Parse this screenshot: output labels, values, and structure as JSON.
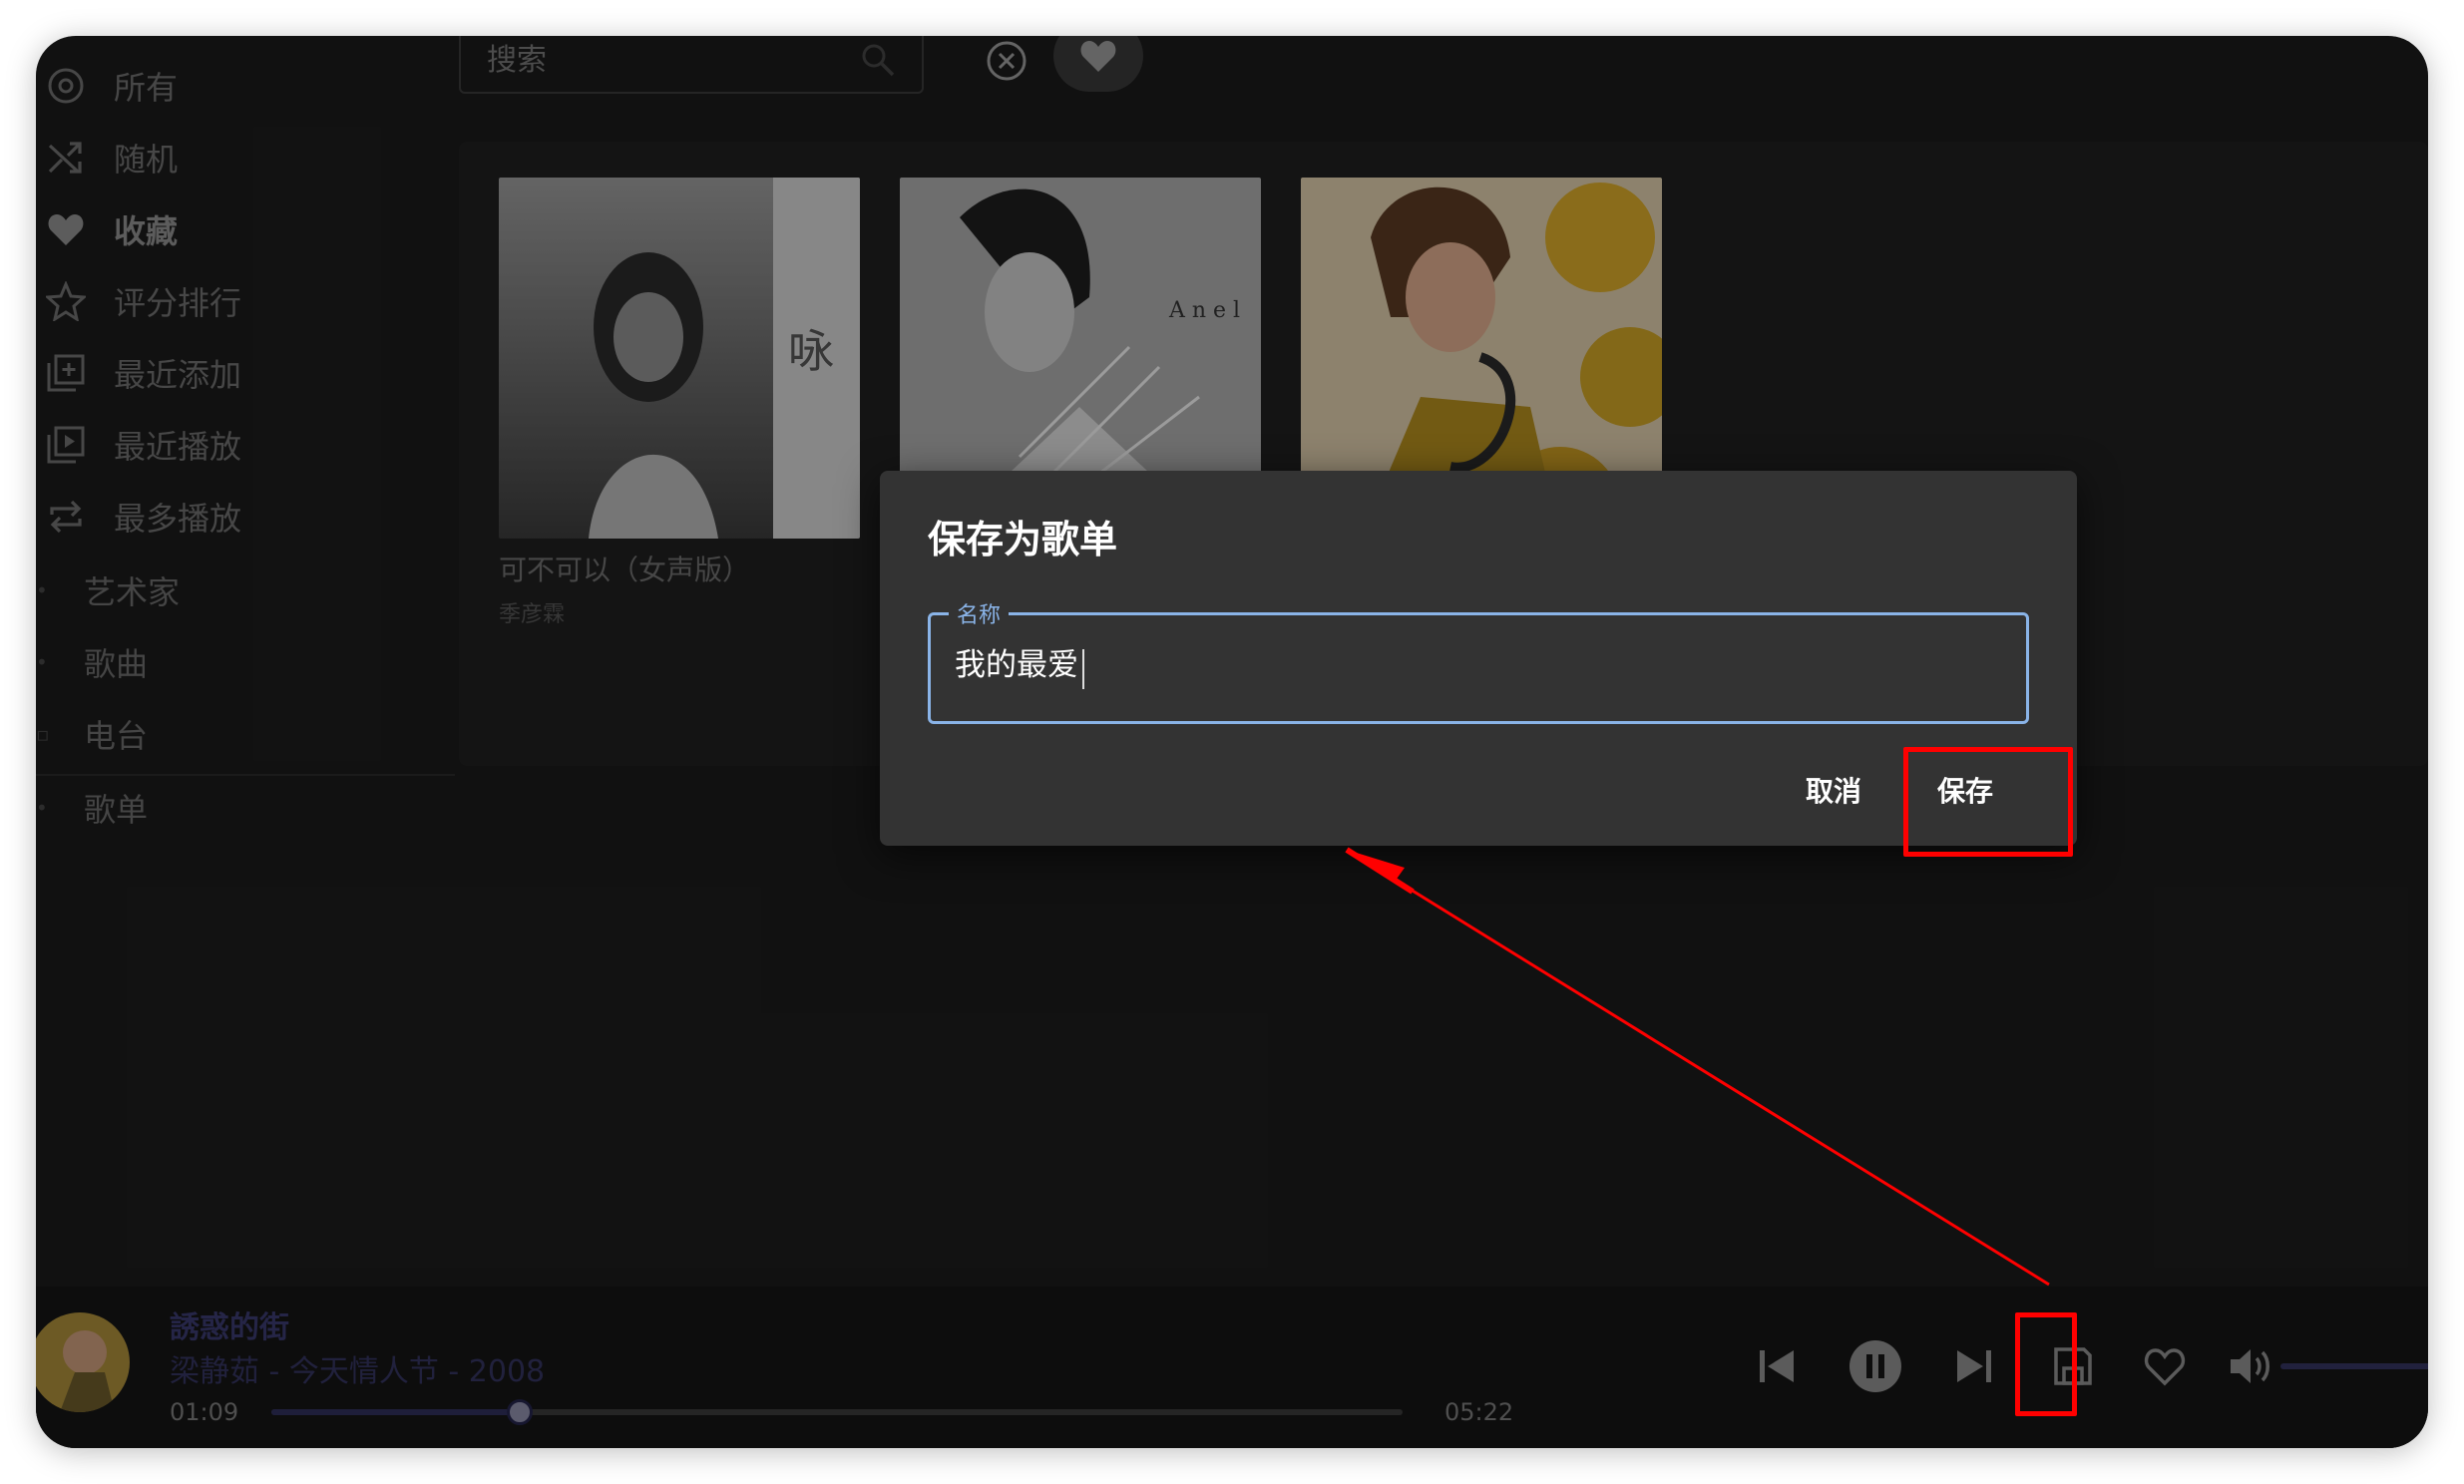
{
  "sidebar": {
    "items": [
      {
        "label": "所有",
        "icon": "disc-icon"
      },
      {
        "label": "随机",
        "icon": "shuffle-icon"
      },
      {
        "label": "收藏",
        "icon": "heart-icon"
      },
      {
        "label": "评分排行",
        "icon": "star-icon"
      },
      {
        "label": "最近添加",
        "icon": "library-add-icon"
      },
      {
        "label": "最近播放",
        "icon": "play-queue-icon"
      },
      {
        "label": "最多播放",
        "icon": "repeat-icon"
      }
    ],
    "sections": [
      "艺术家",
      "歌曲",
      "电台",
      "歌单"
    ],
    "active_index": 2
  },
  "search": {
    "placeholder": "搜索"
  },
  "albums": [
    {
      "title": "可不可以（女声版）",
      "artist": "季彦霖"
    },
    {
      "title": "",
      "artist": ""
    },
    {
      "title": "",
      "artist": ""
    }
  ],
  "dialog": {
    "title": "保存为歌单",
    "field_label": "名称",
    "field_value": "我的最爱",
    "cancel_label": "取消",
    "save_label": "保存"
  },
  "player": {
    "title": "誘惑的街",
    "subtitle": "梁静茹 - 今天情人节 - 2008",
    "current_time": "01:09",
    "total_time": "05:22",
    "progress_fraction": 0.22,
    "volume_fraction": 1.0
  },
  "colors": {
    "accent": "#8ab4e8",
    "annotation": "#ff0000",
    "background": "#1b1b1b",
    "dialog": "#333333"
  }
}
